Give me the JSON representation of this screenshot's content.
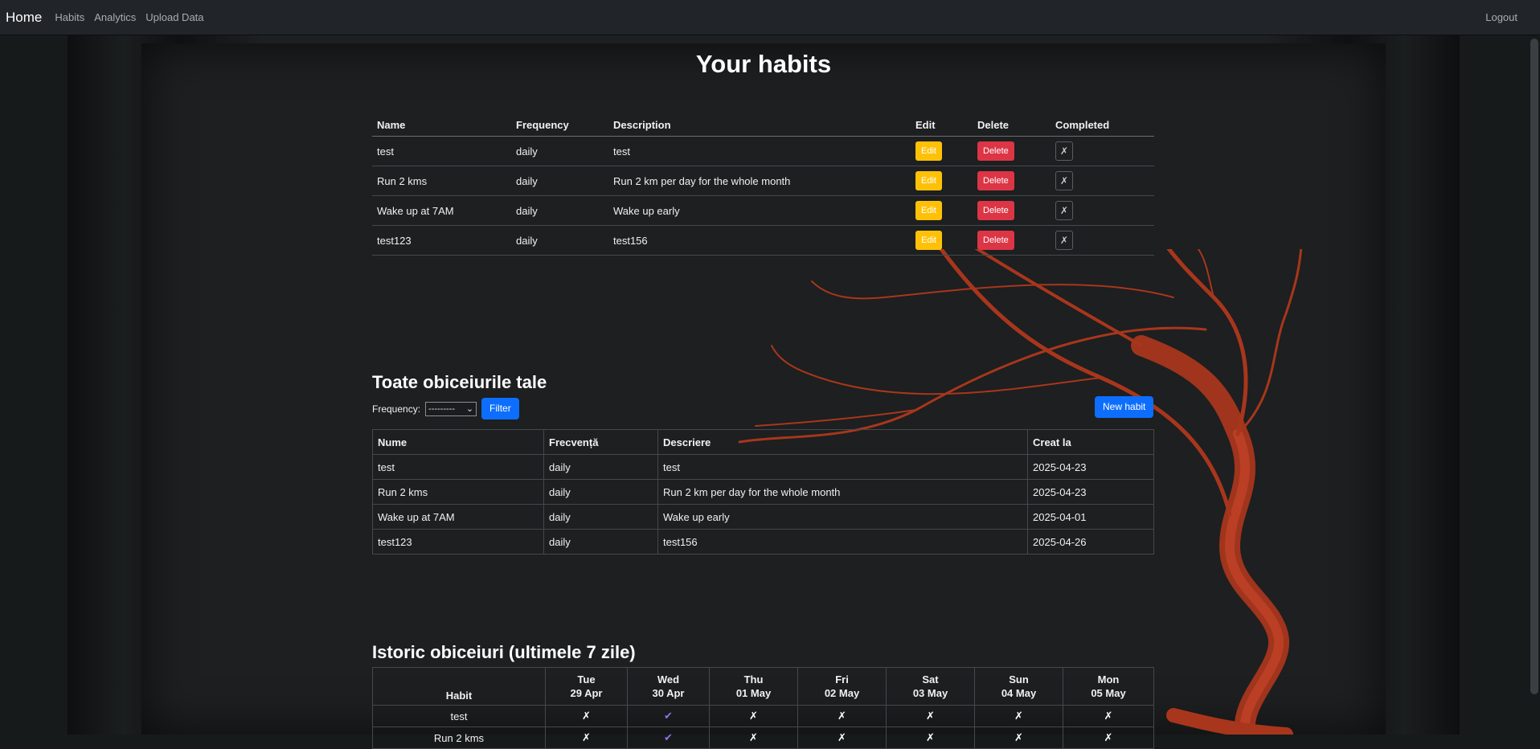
{
  "navbar": {
    "brand": "Home",
    "links": [
      "Habits",
      "Analytics",
      "Upload Data"
    ],
    "logout": "Logout"
  },
  "page_title": "Your habits",
  "habits_table": {
    "headers": [
      "Name",
      "Frequency",
      "Description",
      "Edit",
      "Delete",
      "Completed"
    ],
    "edit_label": "Edit",
    "delete_label": "Delete",
    "completed_mark": "✗",
    "rows": [
      {
        "name": "test",
        "frequency": "daily",
        "description": "test"
      },
      {
        "name": "Run 2 kms",
        "frequency": "daily",
        "description": "Run 2 km per day for the whole month"
      },
      {
        "name": "Wake up at 7AM",
        "frequency": "daily",
        "description": "Wake up early"
      },
      {
        "name": "test123",
        "frequency": "daily",
        "description": "test156"
      }
    ]
  },
  "all_habits": {
    "title": "Toate obiceiurile tale",
    "filter_label": "Frequency:",
    "select_value": "---------",
    "filter_button": "Filter",
    "new_habit_button": "New habit",
    "headers": [
      "Nume",
      "Frecvență",
      "Descriere",
      "Creat la"
    ],
    "rows": [
      {
        "name": "test",
        "frequency": "daily",
        "description": "test",
        "created": "2025-04-23"
      },
      {
        "name": "Run 2 kms",
        "frequency": "daily",
        "description": "Run 2 km per day for the whole month",
        "created": "2025-04-23"
      },
      {
        "name": "Wake up at 7AM",
        "frequency": "daily",
        "description": "Wake up early",
        "created": "2025-04-01"
      },
      {
        "name": "test123",
        "frequency": "daily",
        "description": "test156",
        "created": "2025-04-26"
      }
    ]
  },
  "history": {
    "title": "Istoric obiceiuri (ultimele 7 zile)",
    "habit_header": "Habit",
    "days": [
      {
        "dow": "Tue",
        "date": "29 Apr"
      },
      {
        "dow": "Wed",
        "date": "30 Apr"
      },
      {
        "dow": "Thu",
        "date": "01 May"
      },
      {
        "dow": "Fri",
        "date": "02 May"
      },
      {
        "dow": "Sat",
        "date": "03 May"
      },
      {
        "dow": "Sun",
        "date": "04 May"
      },
      {
        "dow": "Mon",
        "date": "05 May"
      }
    ],
    "rows": [
      {
        "name": "test",
        "marks": [
          "✗",
          "✔",
          "✗",
          "✗",
          "✗",
          "✗",
          "✗"
        ]
      },
      {
        "name": "Run 2 kms",
        "marks": [
          "✗",
          "✔",
          "✗",
          "✗",
          "✗",
          "✗",
          "✗"
        ]
      }
    ]
  },
  "colors": {
    "navbar_bg": "#212529",
    "edit": "#ffc107",
    "delete": "#dc3545",
    "primary": "#0d6efd",
    "check": "#8a75e8",
    "tree": "#b03a1f"
  }
}
